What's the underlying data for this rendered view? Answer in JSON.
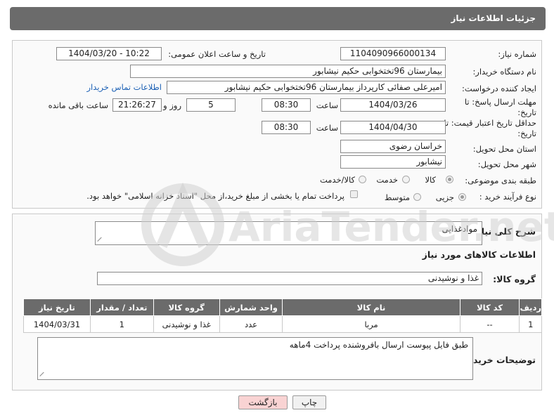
{
  "header": {
    "title": "جزئیات اطلاعات نیاز"
  },
  "form": {
    "need_number_label": "شماره نیاز:",
    "need_number": "1104090966000134",
    "announce_label": "تاریخ و ساعت اعلان عمومی:",
    "announce_value": "1404/03/20 - 10:22",
    "buyer_org_label": "نام دستگاه خریدار:",
    "buyer_org": "بیمارستان 96تختخوابی حکیم نیشابور",
    "requester_label": "ایجاد کننده درخواست:",
    "requester": "امیرعلی صفائی کارپرداز بیمارستان 96تختخوابی حکیم نیشابور",
    "buyer_contact_link": "اطلاعات تماس خریدار",
    "deadline_label": "مهلت ارسال پاسخ: تا تاریخ:",
    "deadline_date": "1404/03/26",
    "time_label": "ساعت",
    "deadline_time": "08:30",
    "days_value": "5",
    "days_label": "روز و",
    "remaining_time": "21:26:27",
    "remaining_label": "ساعت باقی مانده",
    "price_validity_label": "حداقل تاریخ اعتبار قیمت: تا تاریخ:",
    "price_validity_date": "1404/04/30",
    "price_validity_time": "08:30",
    "province_label": "استان محل تحویل:",
    "province": "خراسان رضوی",
    "city_label": "شهر محل تحویل:",
    "city": "نیشابور",
    "category_label": "طبقه بندی موضوعی:",
    "category_options": [
      "کالا",
      "خدمت",
      "کالا/خدمت"
    ],
    "category_selected": "کالا",
    "purchase_type_label": "نوع فرآیند خرید :",
    "purchase_options": [
      "جزیی",
      "متوسط"
    ],
    "purchase_selected": "جزیی",
    "payment_note": "پرداخت تمام یا بخشی از مبلغ خرید،از محل \"اسناد خزانه اسلامی\" خواهد بود."
  },
  "details": {
    "general_desc_label": "شرح کلی نیاز:",
    "general_desc": "موادغذایی",
    "goods_info_title": "اطلاعات کالاهای مورد نیاز",
    "goods_group_label": "گروه کالا:",
    "goods_group": "غذا و نوشیدنی",
    "table": {
      "headers": [
        "ردیف",
        "کد کالا",
        "نام کالا",
        "واحد شمارش",
        "گروه کالا",
        "تعداد / مقدار",
        "تاریخ نیاز"
      ],
      "rows": [
        [
          "1",
          "--",
          "مربا",
          "عدد",
          "غذا و نوشیدنی",
          "1",
          "1404/03/31"
        ]
      ]
    },
    "buyer_notes_label": "توضیحات خریدار:",
    "buyer_notes": "طبق فایل پیوست ارسال بافروشنده پرداخت 4ماهه"
  },
  "buttons": {
    "print": "چاپ",
    "back": "بازگشت"
  },
  "watermark": {
    "text": "AriaTender.net"
  }
}
